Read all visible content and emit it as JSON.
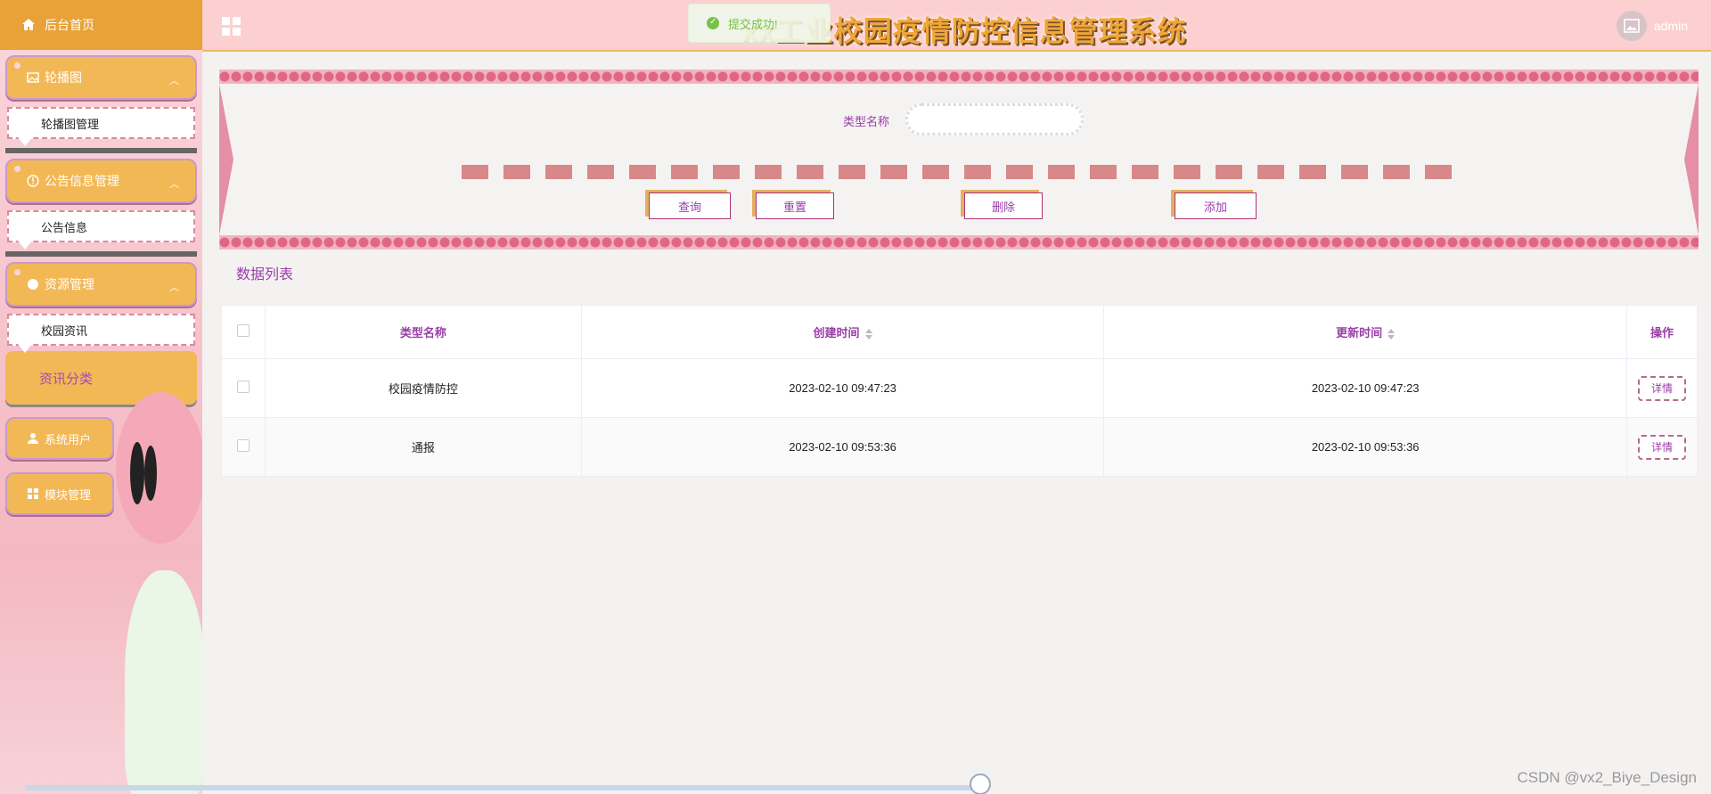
{
  "sidebar": {
    "home": "后台首页",
    "groups": [
      {
        "title": "轮播图",
        "items": [
          "轮播图管理"
        ]
      },
      {
        "title": "公告信息管理",
        "items": [
          "公告信息"
        ]
      },
      {
        "title": "资源管理",
        "items": [
          "校园资讯"
        ]
      }
    ],
    "active_item": "资讯分类",
    "collapsed": [
      {
        "title": "系统用户"
      },
      {
        "title": "模块管理"
      }
    ]
  },
  "header": {
    "title": "xx工业校园疫情防控信息管理系统",
    "toast": "提交成功!",
    "user": "admin"
  },
  "search": {
    "label": "类型名称",
    "input_value": "",
    "buttons": {
      "query": "查询",
      "reset": "重置",
      "delete": "删除",
      "add": "添加"
    }
  },
  "list_title": "数据列表",
  "table": {
    "headers": [
      "类型名称",
      "创建时间",
      "更新时间",
      "操作"
    ],
    "rows": [
      {
        "name": "校园疫情防控",
        "created": "2023-02-10 09:47:23",
        "updated": "2023-02-10 09:47:23",
        "action": "详情"
      },
      {
        "name": "通报",
        "created": "2023-02-10 09:53:36",
        "updated": "2023-02-10 09:53:36",
        "action": "详情"
      }
    ]
  },
  "watermark": "CSDN @vx2_Biye_Design",
  "colors": {
    "accent": "#f3b856",
    "header_bg": "#fcd0d0",
    "text_purple": "#9a3ea8",
    "bead": "#e06685"
  }
}
